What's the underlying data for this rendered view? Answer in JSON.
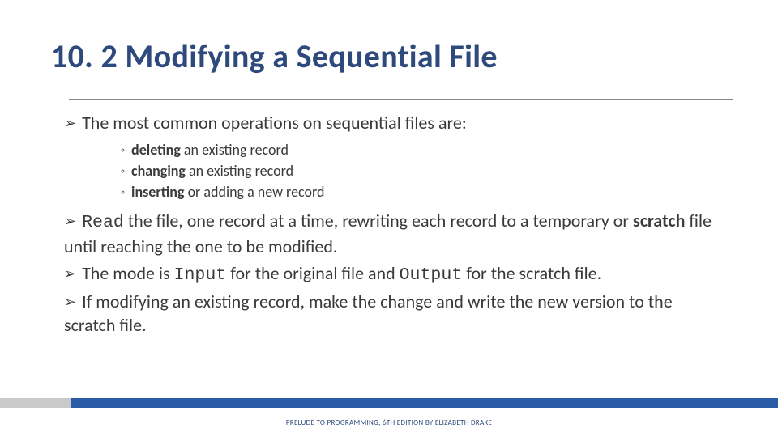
{
  "title": "10. 2 Modifying a Sequential File",
  "bullets": {
    "b1": "The most common operations on sequential files are:",
    "sub1_strong": "deleting",
    "sub1_rest": " an existing record",
    "sub2_strong": "changing",
    "sub2_rest": " an existing record",
    "sub3_strong": "inserting",
    "sub3_rest": " or adding a new record",
    "b2_code": "Read",
    "b2_mid": " the file, one record at a time, rewriting each record to a temporary or ",
    "b2_strong": "scratch",
    "b2_end": " file until reaching the one to be modified.",
    "b3_pre": "The mode is ",
    "b3_code1": "Input",
    "b3_mid": " for the original file and ",
    "b3_code2": "Output",
    "b3_end": " for the scratch file.",
    "b4": "If modifying an existing record, make the change and write the new version to the scratch file."
  },
  "footer": "PRELUDE TO PROGRAMMING, 6TH EDITION BY ELIZABETH DRAKE"
}
